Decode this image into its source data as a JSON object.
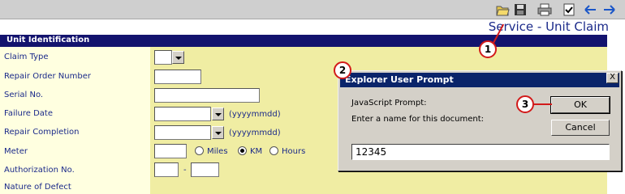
{
  "toolbar": {
    "buttons": [
      "open-folder-icon",
      "save-icon",
      "print-icon",
      "checklist-icon",
      "back-arrow-icon",
      "forward-arrow-icon"
    ]
  },
  "page": {
    "title": "Service - Unit Claim"
  },
  "section": {
    "title": "Unit Identification"
  },
  "form": {
    "claim_type_label": "Claim Type",
    "repair_order_label": "Repair Order Number",
    "serial_label": "Serial No.",
    "failure_date_label": "Failure Date",
    "date_hint": "(yyyymmdd)",
    "repair_completion_label": "Repair Completion",
    "meter_label": "Meter",
    "meter_options": [
      "Miles",
      "KM",
      "Hours"
    ],
    "meter_selected": "KM",
    "authorization_label": "Authorization No.",
    "auth_separator": "-",
    "partial_label": "Nature of Defect"
  },
  "dialog": {
    "title": "Explorer User Prompt",
    "close_label": "X",
    "line1": "JavaScript Prompt:",
    "line2": "Enter a name for this document:",
    "ok_label": "OK",
    "cancel_label": "Cancel",
    "input_value": "12345"
  },
  "callouts": [
    "1",
    "2",
    "3"
  ],
  "colors": {
    "accent": "#d21a1a",
    "title_bar": "#0a246a",
    "section": "#13136e"
  }
}
